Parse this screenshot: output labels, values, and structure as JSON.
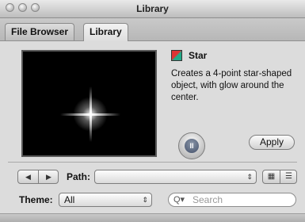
{
  "window": {
    "title": "Library"
  },
  "tabs": [
    {
      "label": "File Browser"
    },
    {
      "label": "Library"
    }
  ],
  "item": {
    "name": "Star",
    "description": "Creates a 4-point star-shaped object, with glow around the center."
  },
  "controls": {
    "pause_glyph": "II",
    "apply_label": "Apply"
  },
  "path": {
    "label": "Path:",
    "value": ""
  },
  "theme": {
    "label": "Theme:",
    "value": "All"
  },
  "search": {
    "placeholder": "Search"
  },
  "glyphs": {
    "back": "◀",
    "forward": "▶",
    "popup_arrows": "⇕",
    "icon_view": "▦",
    "list_view": "☰",
    "magnifier": "Q▾"
  }
}
